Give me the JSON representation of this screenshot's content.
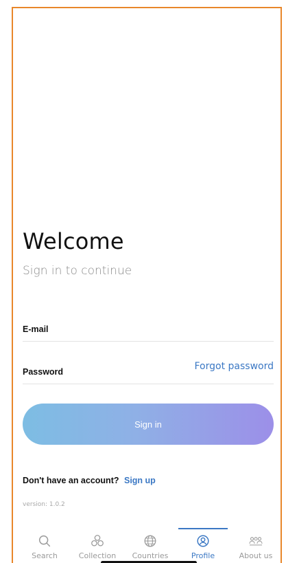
{
  "welcome": {
    "title": "Welcome",
    "subtitle": "Sign in to continue"
  },
  "form": {
    "email_label": "E-mail",
    "email_value": "",
    "password_label": "Password",
    "password_value": "",
    "forgot_password": "Forgot password",
    "sign_in_label": "Sign in"
  },
  "signup": {
    "prompt": "Don't have an account?",
    "link": "Sign up"
  },
  "version": "version: 1.0.2",
  "tabs": [
    {
      "label": "Search",
      "icon": "search-icon",
      "active": false
    },
    {
      "label": "Collection",
      "icon": "collection-icon",
      "active": false
    },
    {
      "label": "Countries",
      "icon": "globe-icon",
      "active": false
    },
    {
      "label": "Profile",
      "icon": "profile-icon",
      "active": true
    },
    {
      "label": "About us",
      "icon": "people-icon",
      "active": false
    }
  ],
  "colors": {
    "accent": "#3b78c4",
    "frame_border": "#e8872a",
    "button_gradient_start": "#7dbde3",
    "button_gradient_end": "#9c8fe8",
    "inactive": "#9a9a9a"
  }
}
